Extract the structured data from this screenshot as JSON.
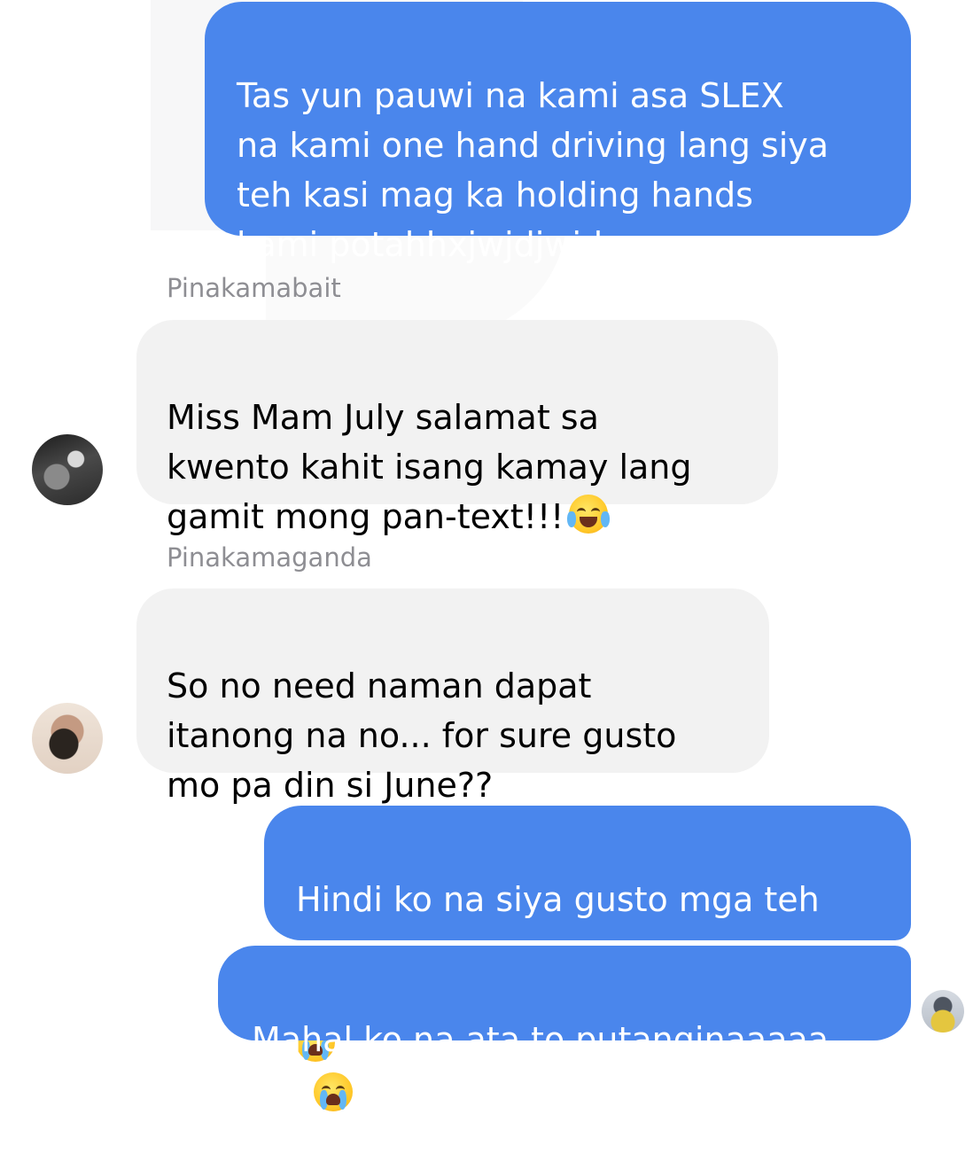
{
  "messages": [
    {
      "type": "outgoing",
      "text": "Tas yun pauwi na kami asa SLEX\nna kami one hand driving lang siya\nteh kasi mag ka holding hands\nkami potahhxjwjdjwjd"
    },
    {
      "type": "incoming",
      "sender": "Pinakamabait",
      "text": "Miss Mam July salamat sa\nkwento kahit isang kamay lang\ngamit mong pan-text!!!",
      "emoji": "face-with-tears-of-joy"
    },
    {
      "type": "incoming",
      "sender": "Pinakamaganda",
      "text": "So no need naman dapat\nitanong na no... for sure gusto\nmo pa din si June??"
    },
    {
      "type": "outgoing",
      "text": "Hindi ko na siya gusto mga teh",
      "emoji": "loudly-crying-face x2"
    },
    {
      "type": "outgoing",
      "text": "Mahal ko na ata to putanginaaaaa"
    }
  ],
  "colors": {
    "outgoing_bubble": "#4a86ec",
    "incoming_bubble": "#f2f2f2",
    "sender_label": "#8e8e93"
  }
}
